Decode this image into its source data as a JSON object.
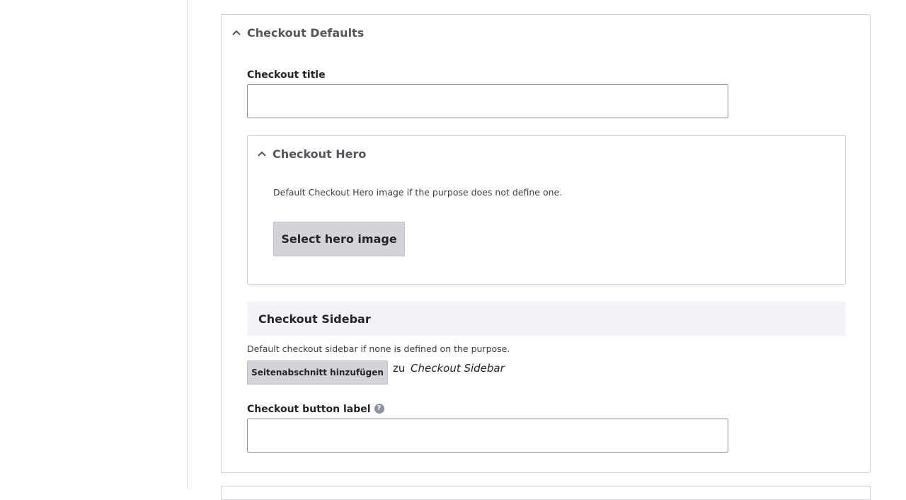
{
  "checkout_defaults": {
    "title": "Checkout Defaults",
    "checkout_title": {
      "label": "Checkout title",
      "value": ""
    },
    "hero": {
      "title": "Checkout Hero",
      "description": "Default Checkout Hero image if the purpose does not define one.",
      "button_label": "Select hero image"
    },
    "sidebar": {
      "title": "Checkout Sidebar",
      "description": "Default checkout sidebar if none is defined on the purpose.",
      "add_button_label": "Seitenabschnitt hinzufügen",
      "connector": "zu",
      "target": "Checkout Sidebar"
    },
    "button_label_field": {
      "label": "Checkout button label",
      "value": "",
      "help_icon": "?"
    }
  },
  "icons": {
    "collapse": "chevron-up-icon",
    "help": "help-icon"
  },
  "colors": {
    "button_bg": "#d3d4d9",
    "region_header_bg": "#f2f2f8",
    "summary_text": "#55565b",
    "border": "#d4d4d8"
  }
}
